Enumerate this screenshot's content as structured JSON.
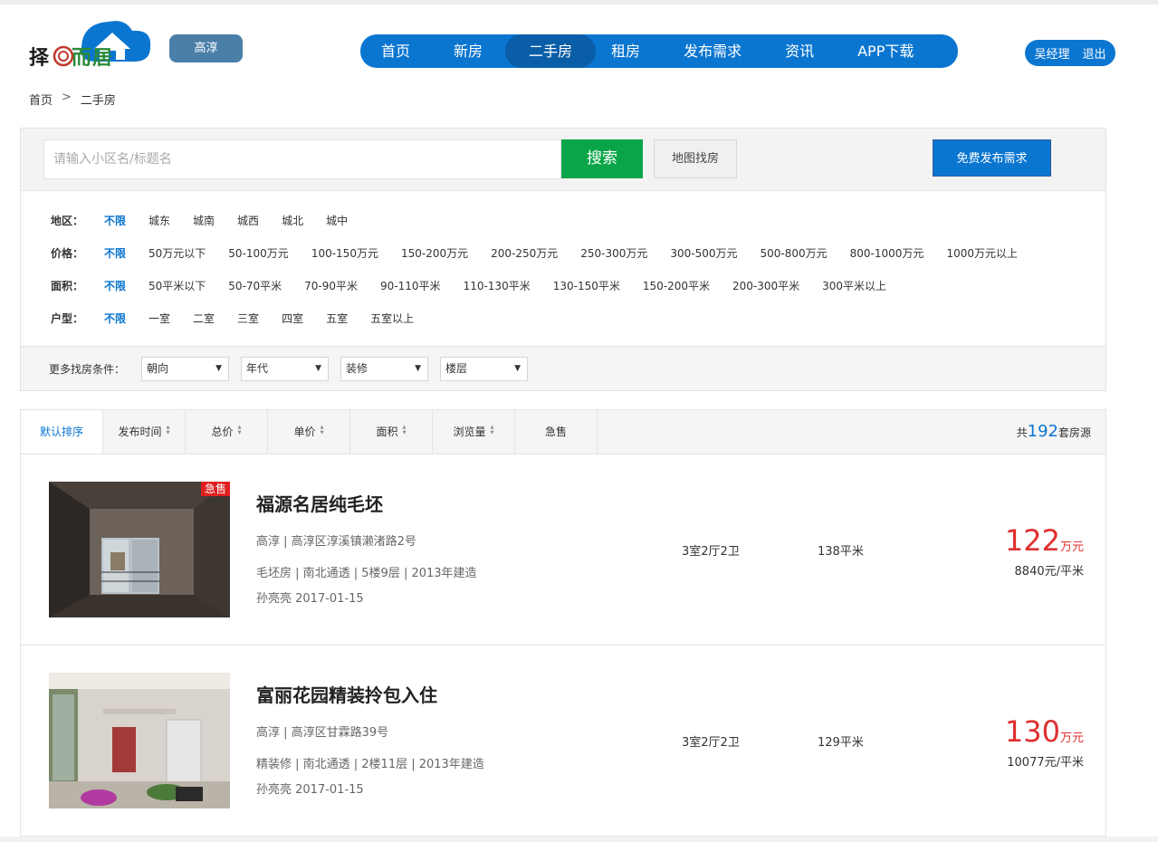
{
  "header": {
    "logo_text_a": "择",
    "logo_text_b": "而居",
    "city": "高淳",
    "nav": [
      "首页",
      "新房",
      "二手房",
      "租房",
      "发布需求",
      "资讯",
      "APP下载"
    ],
    "active_nav_index": 2,
    "user_name": "吴经理",
    "logout": "退出"
  },
  "breadcrumb": {
    "home": "首页",
    "sep": ">",
    "current": "二手房"
  },
  "search": {
    "placeholder": "请输入小区名/标题名",
    "value": "",
    "search_btn": "搜索",
    "map_btn": "地图找房",
    "publish_btn": "免费发布需求"
  },
  "filters": {
    "region": {
      "label": "地区：",
      "options": [
        "不限",
        "城东",
        "城南",
        "城西",
        "城北",
        "城中"
      ]
    },
    "price": {
      "label": "价格：",
      "options": [
        "不限",
        "50万元以下",
        "50-100万元",
        "100-150万元",
        "150-200万元",
        "200-250万元",
        "250-300万元",
        "300-500万元",
        "500-800万元",
        "800-1000万元",
        "1000万元以上"
      ]
    },
    "area": {
      "label": "面积：",
      "options": [
        "不限",
        "50平米以下",
        "50-70平米",
        "70-90平米",
        "90-110平米",
        "110-130平米",
        "130-150平米",
        "150-200平米",
        "200-300平米",
        "300平米以上"
      ]
    },
    "rooms": {
      "label": "户型：",
      "options": [
        "不限",
        "一室",
        "二室",
        "三室",
        "四室",
        "五室",
        "五室以上"
      ]
    }
  },
  "more": {
    "label": "更多找房条件：",
    "dropdowns": [
      "朝向",
      "年代",
      "装修",
      "楼层"
    ]
  },
  "sort": {
    "items": [
      "默认排序",
      "发布时间",
      "总价",
      "单价",
      "面积",
      "浏览量",
      "急售"
    ],
    "total_prefix": "共",
    "total_count": "192",
    "total_suffix": "套房源"
  },
  "listings": [
    {
      "badge": "急售",
      "title": "福源名居纯毛坯",
      "location": "高淳 | 高淳区淳溪镇濑渚路2号",
      "details": "毛坯房 | 南北通透 |  5楼9层 |  2013年建造",
      "agent_date": "孙亮亮 2017-01-15",
      "layout": "3室2厅2卫",
      "area": "138平米",
      "price": "122",
      "price_unit": "万元",
      "unit_price": "8840元/平米"
    },
    {
      "badge": "",
      "title": "富丽花园精装拎包入住",
      "location": "高淳 | 高淳区甘霖路39号",
      "details": "精装修 | 南北通透 |  2楼11层 |  2013年建造",
      "agent_date": "孙亮亮 2017-01-15",
      "layout": "3室2厅2卫",
      "area": "129平米",
      "price": "130",
      "price_unit": "万元",
      "unit_price": "10077元/平米"
    }
  ],
  "colors": {
    "primary": "#0b76d0",
    "green": "#0aa548",
    "price_red": "#e03030",
    "badge_red": "#e02020"
  }
}
